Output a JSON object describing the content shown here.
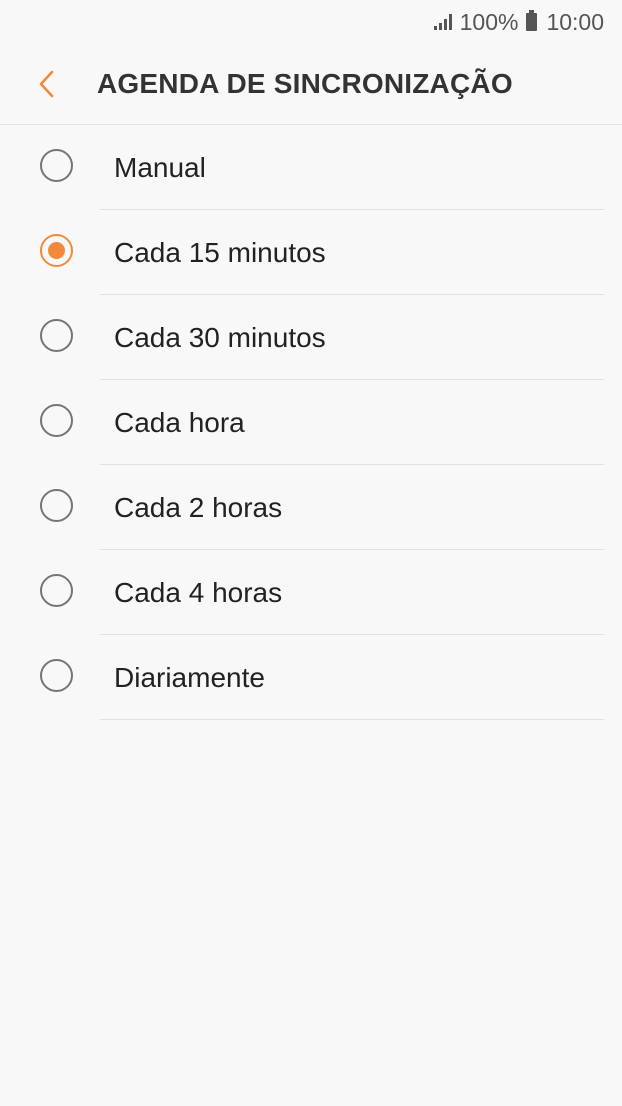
{
  "status_bar": {
    "battery": "100%",
    "time": "10:00",
    "icons": [
      "signal-icon",
      "battery-icon"
    ]
  },
  "header": {
    "back_icon": "chevron-left-icon",
    "title": "AGENDA DE SINCRONIZAÇÃO"
  },
  "colors": {
    "accent": "#f28a3c",
    "background": "#f8f8f8",
    "text": "#222222",
    "radio_unselected": "#757575"
  },
  "sync_options": [
    {
      "label": "Manual",
      "selected": false
    },
    {
      "label": "Cada 15 minutos",
      "selected": true
    },
    {
      "label": "Cada 30 minutos",
      "selected": false
    },
    {
      "label": "Cada hora",
      "selected": false
    },
    {
      "label": "Cada 2 horas",
      "selected": false
    },
    {
      "label": "Cada 4 horas",
      "selected": false
    },
    {
      "label": "Diariamente",
      "selected": false
    }
  ]
}
